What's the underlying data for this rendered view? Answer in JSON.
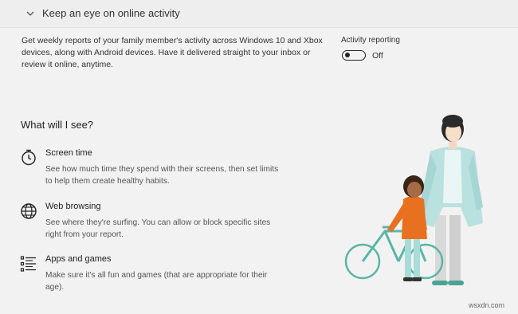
{
  "header": {
    "title": "Keep an eye on online activity",
    "chevron_icon": "chevron-down-icon"
  },
  "description": "Get weekly reports of your family member's activity across Windows 10 and Xbox devices, along with Android devices. Have it delivered straight to your inbox or review it online, anytime.",
  "activity_reporting": {
    "label": "Activity reporting",
    "state": "Off"
  },
  "what_will_i_see": {
    "title": "What will I see?",
    "items": [
      {
        "icon": "stopwatch-icon",
        "title": "Screen time",
        "desc": "See how much time they spend with their screens, then set limits to help them create healthy habits."
      },
      {
        "icon": "globe-icon",
        "title": "Web browsing",
        "desc": "See where they're surfing. You can allow or block specific sites right from your report."
      },
      {
        "icon": "apps-list-icon",
        "title": "Apps and games",
        "desc": "Make sure it's all fun and games (that are appropriate for their age)."
      }
    ]
  },
  "watermark": "wsxdn.com",
  "colors": {
    "background": "#f2f2f2",
    "toggle": "#222222",
    "coat": "#b9e1e0",
    "child_top": "#e8711f",
    "bike": "#59b6a6"
  }
}
